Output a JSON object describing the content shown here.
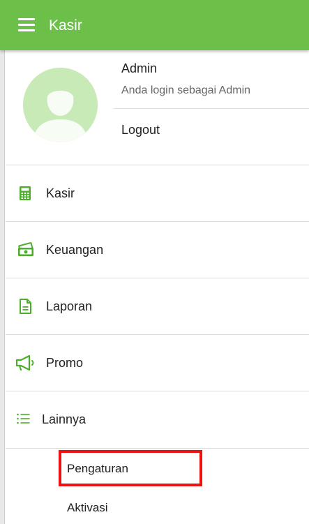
{
  "appbar": {
    "title": "Kasir",
    "color": "#6cc04a",
    "menu_icon": "hamburger-menu-icon"
  },
  "profile": {
    "name": "Admin",
    "subtitle": "Anda login sebagai Admin",
    "logout_label": "Logout",
    "avatar_icon": "user-avatar-icon"
  },
  "menu": {
    "items": [
      {
        "label": "Kasir",
        "icon": "calculator-icon"
      },
      {
        "label": "Keuangan",
        "icon": "money-icon"
      },
      {
        "label": "Laporan",
        "icon": "document-icon"
      },
      {
        "label": "Promo",
        "icon": "megaphone-icon"
      },
      {
        "label": "Lainnya",
        "icon": "list-icon"
      }
    ],
    "submenu": [
      {
        "label": "Pengaturan",
        "highlighted": true
      },
      {
        "label": "Aktivasi"
      }
    ]
  },
  "colors": {
    "accent": "#6cc04a",
    "icon_green": "#4caf2a",
    "highlight": "#ee1111"
  }
}
